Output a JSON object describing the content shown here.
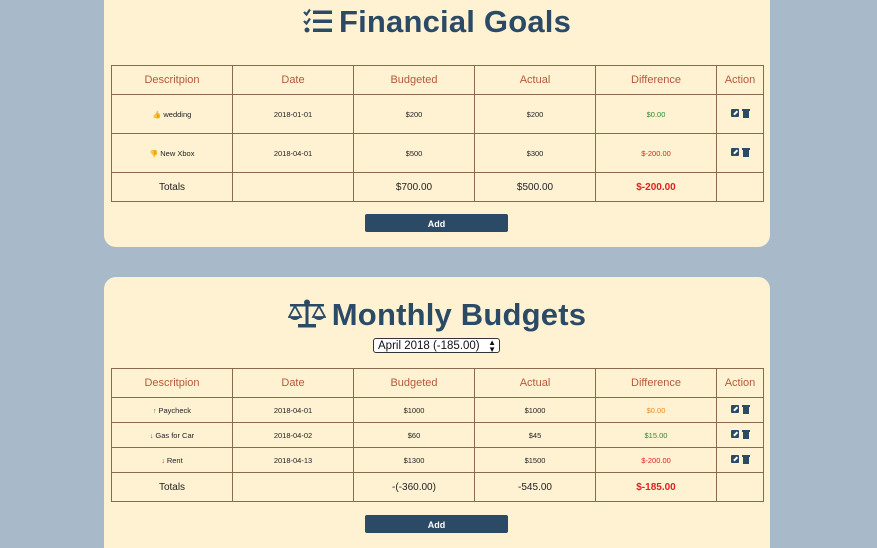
{
  "goals": {
    "title": "Financial Goals",
    "headers": [
      "Descritpion",
      "Date",
      "Budgeted",
      "Actual",
      "Difference",
      "Action"
    ],
    "rows": [
      {
        "description": "wedding",
        "icon": "thumbs-up-icon",
        "date": "2018-01-01",
        "budgeted": "$200",
        "actual": "$200",
        "difference": "$0.00"
      },
      {
        "description": "New Xbox",
        "icon": "thumbs-down-icon",
        "date": "2018-04-01",
        "budgeted": "$500",
        "actual": "$300",
        "difference": "$-200.00"
      }
    ],
    "totals": {
      "label": "Totals",
      "date": "",
      "budgeted": "$700.00",
      "actual": "$500.00",
      "difference": "$-200.00"
    },
    "add_label": "Add"
  },
  "budgets": {
    "title": "Monthly Budgets",
    "selected_month": "April 2018 (-185.00)",
    "headers": [
      "Descritpion",
      "Date",
      "Budgeted",
      "Actual",
      "Difference",
      "Action"
    ],
    "rows": [
      {
        "description": "Paycheck",
        "icon": "arrow-up-icon",
        "date": "2018-04-01",
        "budgeted": "$1000",
        "actual": "$1000",
        "difference": "$0.00"
      },
      {
        "description": "Gas for Car",
        "icon": "arrow-down-icon",
        "date": "2018-04-02",
        "budgeted": "$60",
        "actual": "$45",
        "difference": "$15.00"
      },
      {
        "description": "Rent",
        "icon": "arrow-down-icon",
        "date": "2018-04-13",
        "budgeted": "$1300",
        "actual": "$1500",
        "difference": "$-200.00"
      }
    ],
    "totals": {
      "label": "Totals",
      "date": "",
      "budgeted": "-(-360.00)",
      "actual": "-545.00",
      "difference": "$-185.00"
    },
    "add_label": "Add"
  },
  "colors": {
    "background": "#a8b9c9",
    "card": "#fff2d3",
    "accent": "#2b4a66",
    "header_text": "#b35a3a",
    "positive": "#2f8a2f",
    "negative": "#e02020",
    "zero": "#f08a20"
  }
}
